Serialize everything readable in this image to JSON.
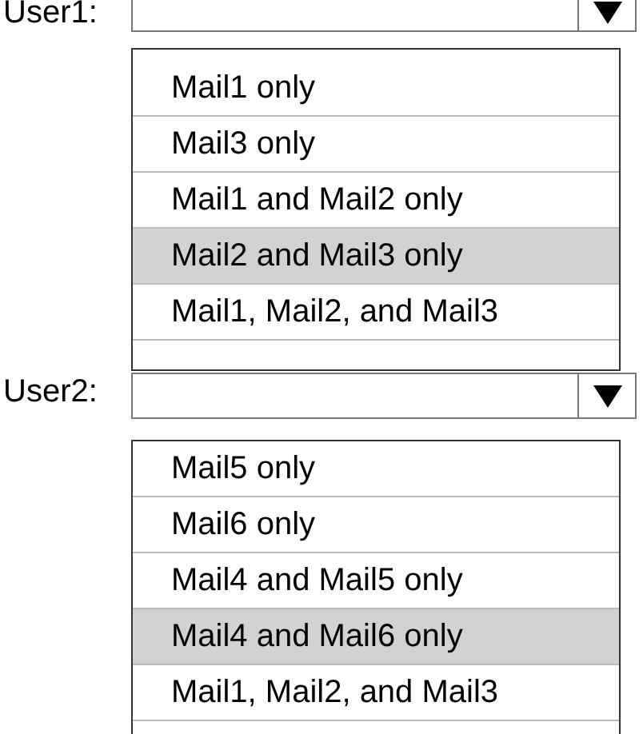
{
  "questions": [
    {
      "label": "User1:",
      "options": [
        {
          "text": "Mail1 only",
          "selected": false
        },
        {
          "text": "Mail3 only",
          "selected": false
        },
        {
          "text": "Mail1 and Mail2 only",
          "selected": false
        },
        {
          "text": "Mail2 and Mail3 only",
          "selected": true
        },
        {
          "text": "Mail1, Mail2, and Mail3",
          "selected": false
        }
      ]
    },
    {
      "label": "User2:",
      "options": [
        {
          "text": "Mail5 only",
          "selected": false
        },
        {
          "text": "Mail6 only",
          "selected": false
        },
        {
          "text": "Mail4 and Mail5 only",
          "selected": false
        },
        {
          "text": "Mail4 and Mail6 only",
          "selected": true
        },
        {
          "text": "Mail1, Mail2, and Mail3",
          "selected": false
        }
      ]
    }
  ]
}
